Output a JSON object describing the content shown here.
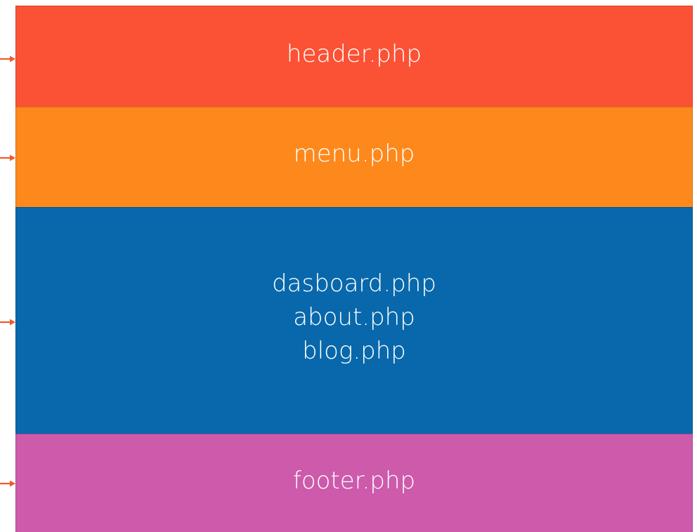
{
  "blocks": [
    {
      "id": "header",
      "color": "#fb5235",
      "lines": [
        "header.php"
      ]
    },
    {
      "id": "menu",
      "color": "#fd881b",
      "lines": [
        "menu.php"
      ]
    },
    {
      "id": "content",
      "color": "#0868ab",
      "lines": [
        "dasboard.php",
        "about.php",
        "blog.php"
      ]
    },
    {
      "id": "footer",
      "color": "#cd5aab",
      "lines": [
        "footer.php"
      ]
    }
  ],
  "arrow_color": "#f05a28"
}
